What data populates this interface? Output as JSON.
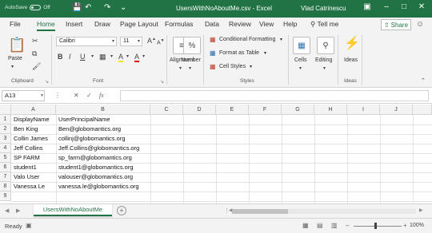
{
  "titlebar": {
    "autosave_label": "AutoSave",
    "autosave_state": "Off",
    "title": "UsersWithNoAboutMe.csv  -  Excel",
    "user": "Vlad Catrinescu",
    "save_icon": "save-icon",
    "undo_icon": "undo-icon",
    "redo_icon": "redo-icon"
  },
  "ribbon_tabs": [
    "File",
    "Home",
    "Insert",
    "Draw",
    "Page Layout",
    "Formulas",
    "Data",
    "Review",
    "View",
    "Help"
  ],
  "active_tab": "Home",
  "tell_me": "Tell me",
  "share_label": "Share",
  "ribbon": {
    "clipboard": {
      "paste_label": "Paste",
      "group_label": "Clipboard"
    },
    "font": {
      "font_name": "Calibri",
      "font_size": "11",
      "group_label": "Font",
      "bold": "B",
      "italic": "I",
      "underline": "U",
      "grow": "A",
      "shrink": "A",
      "fill": "A",
      "color": "A"
    },
    "alignment": {
      "label": "Alignment"
    },
    "number": {
      "label": "Number",
      "symbol": "%"
    },
    "styles": {
      "conditional": "Conditional Formatting",
      "format_table": "Format as Table",
      "cell_styles": "Cell Styles",
      "group_label": "Styles"
    },
    "cells": {
      "label": "Cells"
    },
    "editing": {
      "label": "Editing"
    },
    "ideas": {
      "label": "Ideas",
      "group_label": "Ideas"
    }
  },
  "formula_bar": {
    "name_box": "A13",
    "fx": "fx",
    "value": ""
  },
  "grid": {
    "columns": [
      "A",
      "B",
      "C",
      "D",
      "E",
      "F",
      "G",
      "H",
      "I",
      "J"
    ],
    "rows": [
      "1",
      "2",
      "3",
      "4",
      "5",
      "6",
      "7",
      "8",
      "9"
    ],
    "cells_a": [
      "DisplayName",
      "Ben King",
      "Collin James",
      "Jeff Collins",
      "SP FARM",
      "student1",
      "Valo User",
      "Vanessa Le",
      ""
    ],
    "cells_b": [
      "UserPrincipalName",
      "Ben@globomantics.org",
      "collinj@globomantics.org",
      "Jeff.Collins@globomantics.org",
      "sp_farm@globomantics.org",
      "student1@globomantics.org",
      "valouser@globomantics.org",
      "vanessa.le@globomantics.org",
      ""
    ]
  },
  "sheet_tab": "UsersWithNoAboutMe",
  "status": {
    "ready": "Ready",
    "zoom": "100%"
  }
}
